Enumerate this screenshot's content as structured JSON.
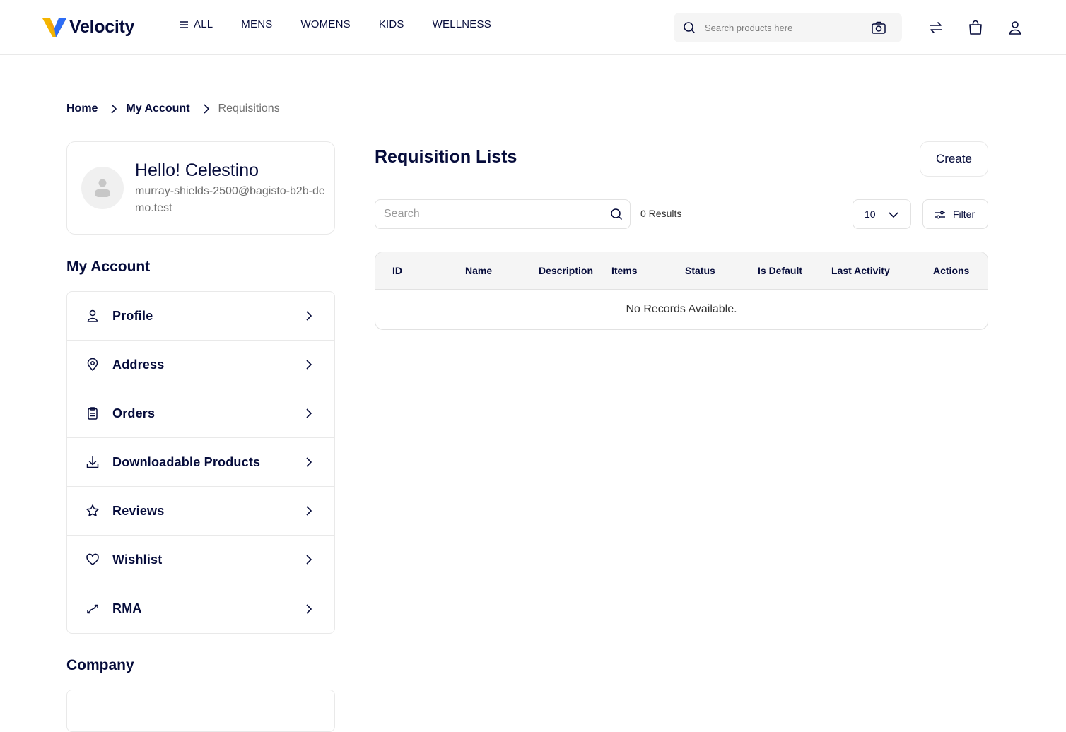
{
  "header": {
    "logo_text": "Velocity",
    "nav": [
      "ALL",
      "MENS",
      "WOMENS",
      "KIDS",
      "WELLNESS"
    ],
    "search_placeholder": "Search products here",
    "icons": [
      "search-icon",
      "camera-icon",
      "compare-icon",
      "cart-icon",
      "user-icon"
    ]
  },
  "breadcrumb": [
    "Home",
    "My Account",
    "Requisitions"
  ],
  "profile": {
    "greeting": "Hello! Celestino",
    "email": "murray-shields-2500@bagisto-b2b-demo.test"
  },
  "sidebar": {
    "account_title": "My Account",
    "items": [
      {
        "label": "Profile",
        "icon": "user-icon"
      },
      {
        "label": "Address",
        "icon": "location-icon"
      },
      {
        "label": "Orders",
        "icon": "clipboard-icon"
      },
      {
        "label": "Downloadable Products",
        "icon": "download-icon"
      },
      {
        "label": "Reviews",
        "icon": "star-icon"
      },
      {
        "label": "Wishlist",
        "icon": "heart-icon"
      },
      {
        "label": "RMA",
        "icon": "rma-icon"
      }
    ],
    "company_title": "Company"
  },
  "main": {
    "title": "Requisition Lists",
    "create_label": "Create",
    "search_placeholder": "Search",
    "results": "0 Results",
    "per_page": "10",
    "filter_label": "Filter",
    "columns": [
      "ID",
      "Name",
      "Description",
      "Items",
      "Status",
      "Is Default",
      "Last Activity",
      "Actions"
    ],
    "empty_text": "No Records Available."
  },
  "colors": {
    "text": "#060c3b",
    "muted": "#6e6e6e",
    "border": "#e9e9e9",
    "logo_yellow": "#f4b400",
    "logo_blue": "#2d6df6"
  }
}
